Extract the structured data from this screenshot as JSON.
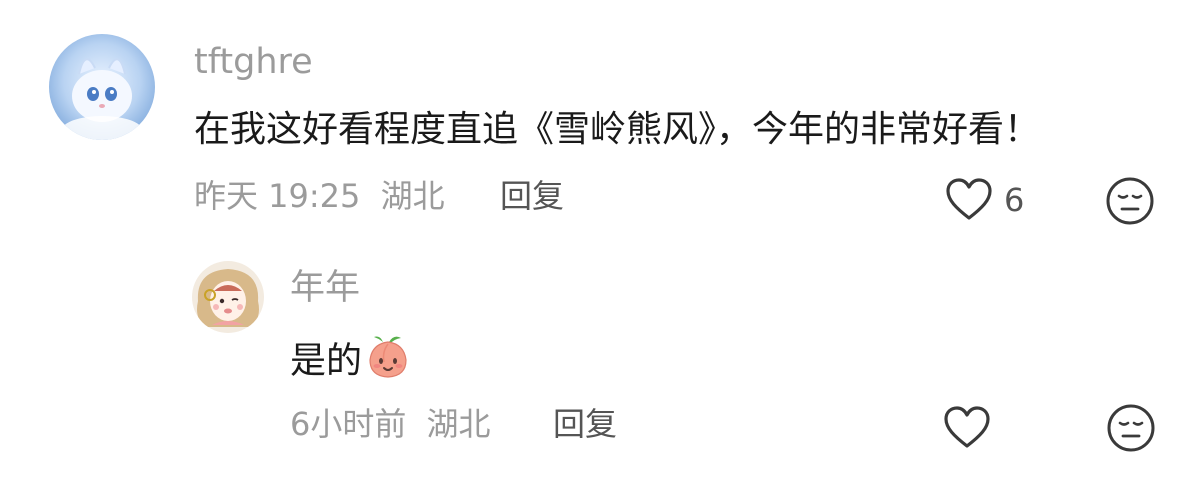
{
  "comments": [
    {
      "username": "tftghre",
      "content": "在我这好看程度直追《雪岭熊风》，今年的非常好看！",
      "time": "昨天 19:25",
      "location": "湖北",
      "reply_label": "回复",
      "like_count": "6"
    },
    {
      "username": "年年",
      "content": "是的",
      "time": "6小时前",
      "location": "湖北",
      "reply_label": "回复",
      "like_count": ""
    }
  ],
  "icons": {
    "like": "heart-outline-icon",
    "dislike": "meh-face-icon",
    "emoji": "peach-emoji-icon"
  },
  "colors": {
    "meta": "#9b9b9b",
    "text": "#1a1a1a",
    "icon": "#3a3a3a"
  }
}
